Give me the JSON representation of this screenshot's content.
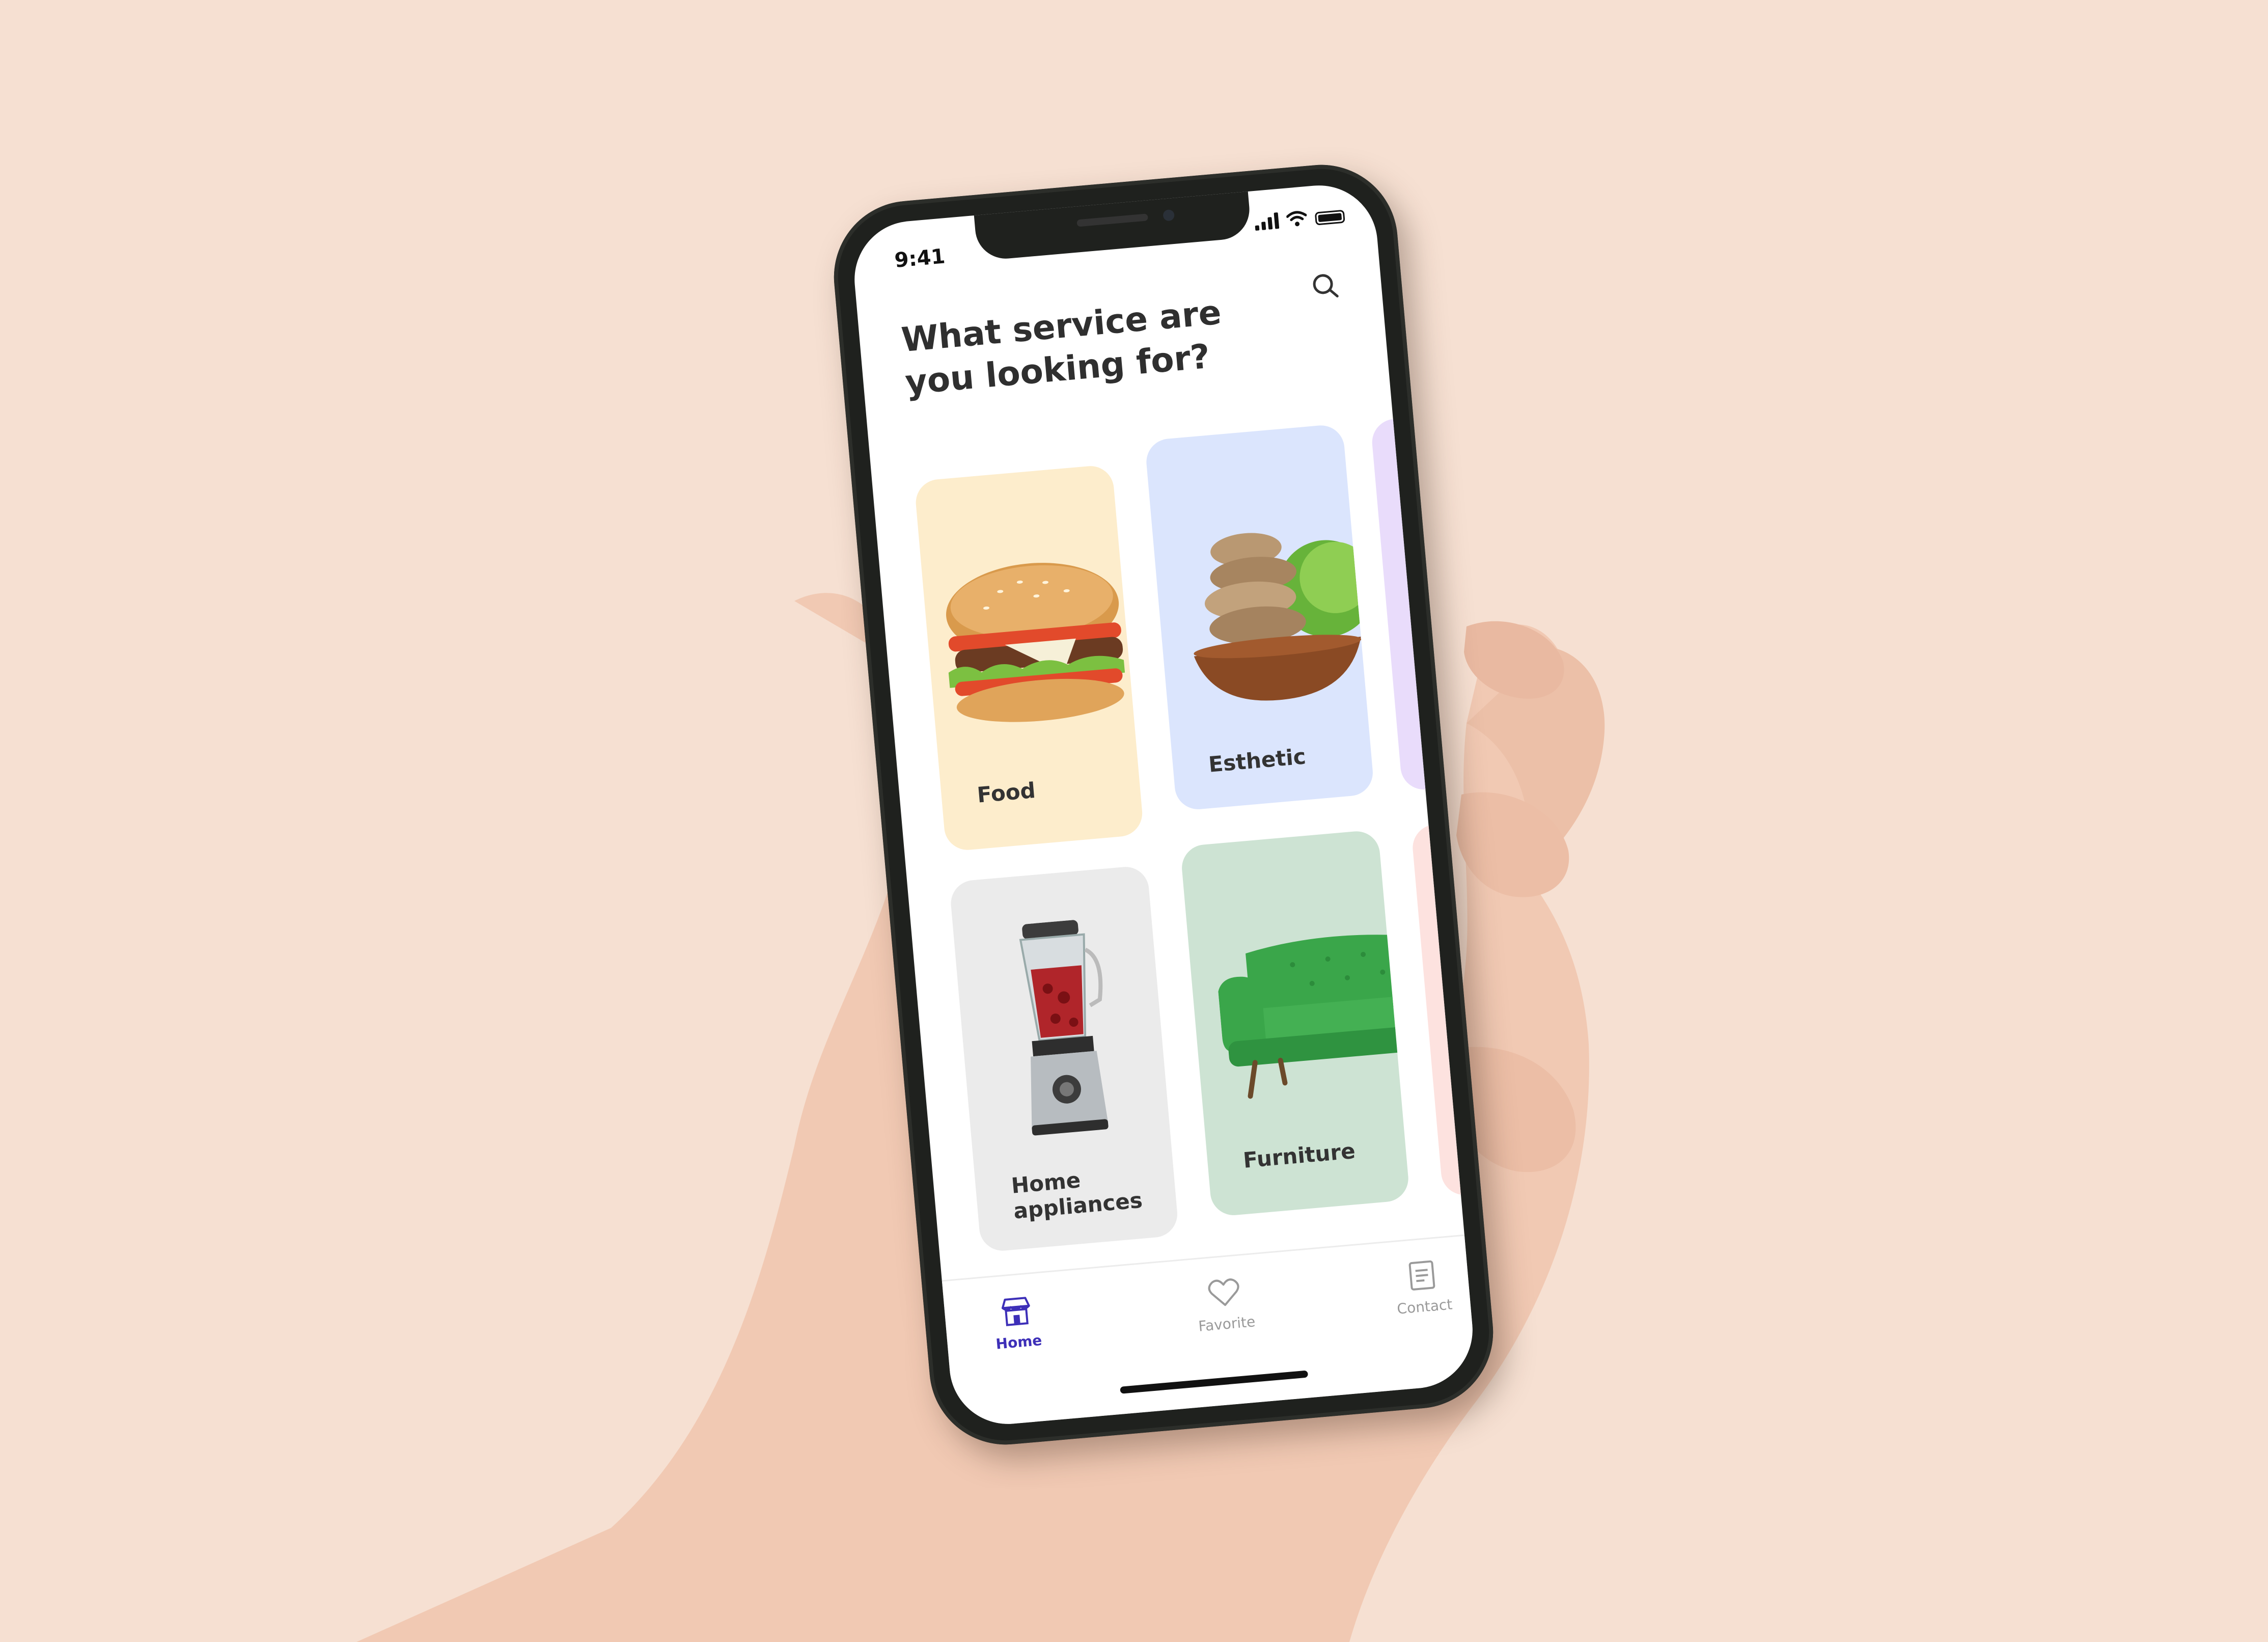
{
  "status_bar": {
    "time": "9:41",
    "icons": [
      "signal-icon",
      "wifi-icon",
      "battery-icon"
    ]
  },
  "header": {
    "title": "What service are you looking for?",
    "search_icon": "search-icon"
  },
  "categories": [
    {
      "label": "Food",
      "color": "#fdedcc",
      "icon": "burger-image"
    },
    {
      "label": "Esthetic",
      "color": "#dbe5fd",
      "icon": "spa-stones-image"
    },
    {
      "label": "Home appliances",
      "color": "#ebebeb",
      "icon": "blender-image"
    },
    {
      "label": "Furniture",
      "color": "#cde3d3",
      "icon": "sofa-image"
    }
  ],
  "peek_cards": [
    {
      "color": "#e9dcfb"
    },
    {
      "color": "#fde2df"
    }
  ],
  "tabbar": {
    "items": [
      {
        "label": "Home",
        "icon": "home-icon",
        "active": true
      },
      {
        "label": "Favorite",
        "icon": "heart-icon",
        "active": false
      },
      {
        "label": "Contact",
        "icon": "contact-icon",
        "active": false
      }
    ],
    "active_color": "#3d2fb8",
    "inactive_color": "#9a9a9a"
  }
}
